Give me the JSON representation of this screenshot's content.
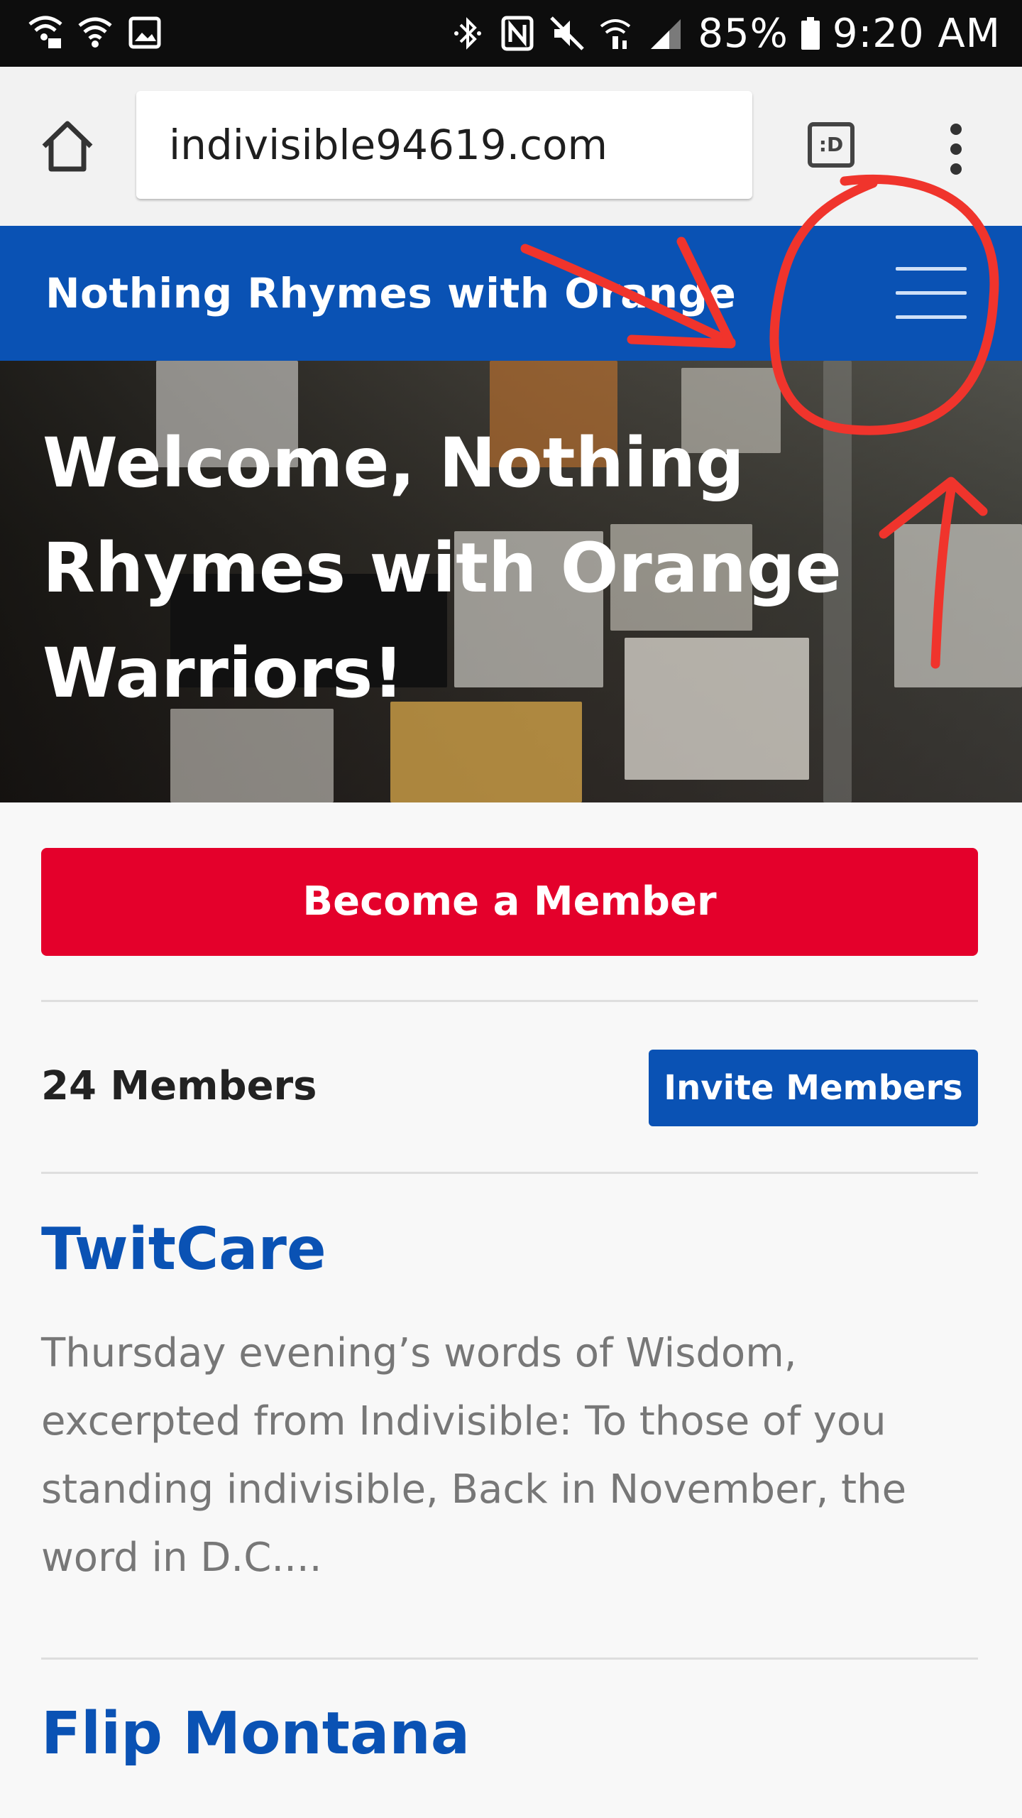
{
  "status_bar": {
    "battery": "85%",
    "time": "9:20 AM",
    "icons": [
      "wifi-lock-icon",
      "wifi-icon",
      "image-icon",
      "bluetooth-icon",
      "nfc-icon",
      "mute-icon",
      "wifi-calling-icon",
      "signal-icon",
      "battery-icon"
    ]
  },
  "browser": {
    "url": "indivisible94619.com",
    "tab_label": ":D",
    "icons": [
      "home-icon",
      "tab-switcher-icon",
      "more-vert-icon"
    ]
  },
  "header": {
    "site_title": "Nothing Rhymes with Orange",
    "menu_icon": "hamburger-menu-icon"
  },
  "hero": {
    "heading": "Welcome, Nothing Rhymes with Orange Warriors!"
  },
  "actions": {
    "become_member": "Become a Member",
    "member_count": "24 Members",
    "invite_members": "Invite Members"
  },
  "posts": [
    {
      "title": "TwitCare",
      "excerpt": "Thursday evening’s words of Wisdom, excerpted from Indivisible: To those of you standing indivisible, Back in November, the word in D.C...."
    },
    {
      "title": "Flip Montana"
    }
  ],
  "colors": {
    "brand_blue": "#0a52b4",
    "cta_red": "#e4002b",
    "annotation_red": "#f0342c"
  }
}
